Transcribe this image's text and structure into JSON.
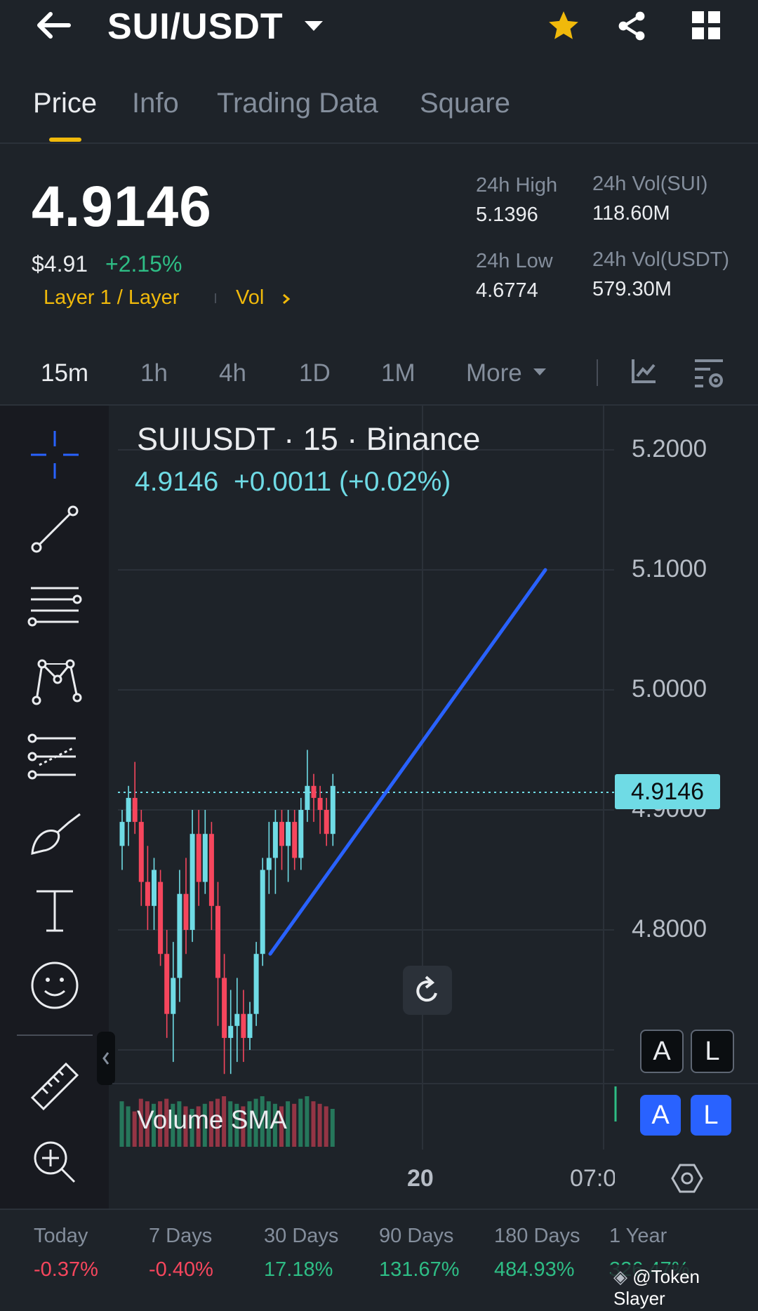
{
  "header": {
    "pair": "SUI/USDT"
  },
  "tabs": [
    "Price",
    "Info",
    "Trading Data",
    "Square"
  ],
  "price": {
    "last": "4.9146",
    "usd": "$4.91",
    "change": "+2.15%",
    "category": "Layer 1 / Layer",
    "vol_link": "Vol"
  },
  "stats": {
    "high_label": "24h High",
    "high_value": "5.1396",
    "low_label": "24h Low",
    "low_value": "4.6774",
    "vol_sui_label": "24h Vol(SUI)",
    "vol_sui_value": "118.60M",
    "vol_usdt_label": "24h Vol(USDT)",
    "vol_usdt_value": "579.30M"
  },
  "intervals": [
    "15m",
    "1h",
    "4h",
    "1D",
    "1M",
    "More"
  ],
  "chart": {
    "title": "SUIUSDT · 15 · Binance",
    "ohlc_line": "4.9146  +0.0011 (+0.02%)",
    "price_tag": "4.9146",
    "volume_label": "Volume SMA",
    "x_tick_1": "20",
    "x_tick_2": "07:0",
    "btn_a": "A",
    "btn_l": "L"
  },
  "chart_data": {
    "type": "candlestick",
    "title": "SUIUSDT · 15 · Binance",
    "y_ticks": [
      "5.2000",
      "5.1000",
      "5.0000",
      "4.9000",
      "4.8000"
    ],
    "ylim": [
      4.64,
      5.22
    ],
    "last_price": 4.9146,
    "x_ticks": [
      "20",
      "07:0"
    ],
    "trendline": {
      "from": 4.78,
      "to": 5.1
    },
    "candles": [
      [
        4.87,
        4.9,
        4.85,
        4.89
      ],
      [
        4.89,
        4.92,
        4.87,
        4.91
      ],
      [
        4.91,
        4.94,
        4.88,
        4.89
      ],
      [
        4.89,
        4.9,
        4.82,
        4.84
      ],
      [
        4.84,
        4.87,
        4.8,
        4.82
      ],
      [
        4.82,
        4.86,
        4.8,
        4.85
      ],
      [
        4.84,
        4.85,
        4.77,
        4.78
      ],
      [
        4.78,
        4.8,
        4.71,
        4.73
      ],
      [
        4.73,
        4.79,
        4.69,
        4.76
      ],
      [
        4.76,
        4.85,
        4.74,
        4.83
      ],
      [
        4.83,
        4.86,
        4.78,
        4.8
      ],
      [
        4.8,
        4.9,
        4.79,
        4.88
      ],
      [
        4.88,
        4.9,
        4.82,
        4.84
      ],
      [
        4.84,
        4.9,
        4.83,
        4.88
      ],
      [
        4.88,
        4.89,
        4.8,
        4.82
      ],
      [
        4.82,
        4.84,
        4.72,
        4.76
      ],
      [
        4.76,
        4.78,
        4.68,
        4.71
      ],
      [
        4.71,
        4.75,
        4.68,
        4.72
      ],
      [
        4.72,
        4.76,
        4.69,
        4.73
      ],
      [
        4.73,
        4.75,
        4.69,
        4.71
      ],
      [
        4.71,
        4.74,
        4.7,
        4.73
      ],
      [
        4.73,
        4.79,
        4.72,
        4.78
      ],
      [
        4.78,
        4.86,
        4.77,
        4.85
      ],
      [
        4.85,
        4.89,
        4.83,
        4.86
      ],
      [
        4.86,
        4.9,
        4.83,
        4.89
      ],
      [
        4.89,
        4.9,
        4.85,
        4.87
      ],
      [
        4.87,
        4.9,
        4.84,
        4.89
      ],
      [
        4.89,
        4.9,
        4.85,
        4.86
      ],
      [
        4.86,
        4.91,
        4.85,
        4.9
      ],
      [
        4.9,
        4.95,
        4.89,
        4.92
      ],
      [
        4.92,
        4.93,
        4.89,
        4.91
      ],
      [
        4.91,
        4.92,
        4.88,
        4.9
      ],
      [
        4.9,
        4.91,
        4.87,
        4.88
      ],
      [
        4.88,
        4.93,
        4.87,
        4.92
      ]
    ],
    "volume": [
      0.9,
      0.8,
      0.7,
      0.95,
      0.9,
      0.85,
      0.9,
      0.95,
      0.85,
      0.9,
      0.8,
      0.75,
      0.8,
      0.85,
      0.9,
      0.95,
      1.0,
      0.9,
      0.85,
      0.8,
      0.9,
      0.95,
      1.0,
      0.9,
      0.85,
      0.8,
      0.9,
      0.85,
      0.95,
      1.0,
      0.9,
      0.85,
      0.8,
      0.75
    ]
  },
  "performance": [
    {
      "label": "Today",
      "value": "-0.37%",
      "color": "#f6465d"
    },
    {
      "label": "7 Days",
      "value": "-0.40%",
      "color": "#f6465d"
    },
    {
      "label": "30 Days",
      "value": "17.18%",
      "color": "#2ebd85"
    },
    {
      "label": "90 Days",
      "value": "131.67%",
      "color": "#2ebd85"
    },
    {
      "label": "180 Days",
      "value": "484.93%",
      "color": "#2ebd85"
    },
    {
      "label": "1 Year",
      "value": "326.47%",
      "color": "#2ebd85"
    }
  ],
  "watermark": "@Token Slayer",
  "colors": {
    "up": "#6fdbe5",
    "down": "#f6465d",
    "accent": "#f0b90b",
    "trend": "#2962ff"
  }
}
